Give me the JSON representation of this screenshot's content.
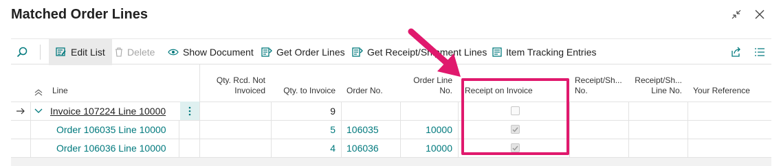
{
  "page": {
    "title": "Matched Order Lines"
  },
  "toolbar": {
    "edit_list": "Edit List",
    "delete": "Delete",
    "show_document": "Show Document",
    "get_order_lines": "Get Order Lines",
    "get_receipt_shipment_lines": "Get Receipt/Shipment Lines",
    "item_tracking_entries": "Item Tracking Entries"
  },
  "grid": {
    "columns": {
      "line": "Line",
      "qty_rcd_not_invoiced": "Qty. Rcd. Not Invoiced",
      "qty_to_invoice": "Qty. to Invoice",
      "order_no": "Order No.",
      "order_line_no": "Order Line No.",
      "receipt_on_invoice": "Receipt on Invoice",
      "receipt_shipment_no": "Receipt/Sh... No.",
      "receipt_shipment_line_no": "Receipt/Sh... Line No.",
      "your_reference": "Your Reference"
    },
    "rows": [
      {
        "line": "Invoice 107224 Line 10000",
        "qty_rcd_not_invoiced": "",
        "qty_to_invoice": "9",
        "order_no": "",
        "order_line_no": "",
        "receipt_on_invoice": false,
        "receipt_shipment_no": "",
        "receipt_shipment_line_no": "",
        "your_reference": ""
      },
      {
        "line": "Order 106035 Line 10000",
        "qty_rcd_not_invoiced": "",
        "qty_to_invoice": "5",
        "order_no": "106035",
        "order_line_no": "10000",
        "receipt_on_invoice": true,
        "receipt_shipment_no": "",
        "receipt_shipment_line_no": "",
        "your_reference": ""
      },
      {
        "line": "Order 106036 Line 10000",
        "qty_rcd_not_invoiced": "",
        "qty_to_invoice": "4",
        "order_no": "106036",
        "order_line_no": "10000",
        "receipt_on_invoice": true,
        "receipt_shipment_no": "",
        "receipt_shipment_line_no": "",
        "your_reference": ""
      }
    ]
  },
  "colors": {
    "accent_teal": "#00797d",
    "highlight_pink": "#e0196d"
  },
  "icons": [
    "collapse-icon",
    "close-icon",
    "search-icon",
    "edit-list-icon",
    "delete-icon",
    "show-document-icon",
    "get-order-lines-icon",
    "get-receipt-lines-icon",
    "item-tracking-icon",
    "share-icon",
    "list-view-icon",
    "collapse-all-icon",
    "row-pointer-icon",
    "row-collapse-icon",
    "more-options-icon"
  ]
}
